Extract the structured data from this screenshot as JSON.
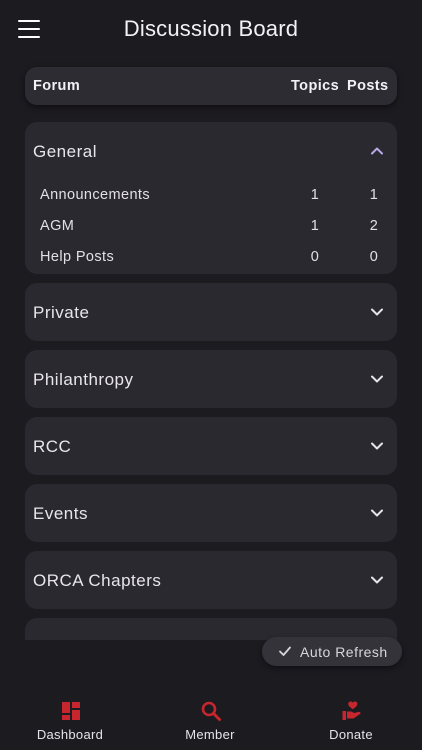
{
  "header": {
    "title": "Discussion Board",
    "menu_icon": "hamburger-menu-icon"
  },
  "columns": {
    "forum": "Forum",
    "topics": "Topics",
    "posts": "Posts"
  },
  "forums": [
    {
      "name": "General",
      "expanded": true,
      "subforums": [
        {
          "name": "Announcements",
          "topics": "1",
          "posts": "1"
        },
        {
          "name": "AGM",
          "topics": "1",
          "posts": "2"
        },
        {
          "name": "Help Posts",
          "topics": "0",
          "posts": "0"
        }
      ]
    },
    {
      "name": "Private",
      "expanded": false
    },
    {
      "name": "Philanthropy",
      "expanded": false
    },
    {
      "name": "RCC",
      "expanded": false
    },
    {
      "name": "Events",
      "expanded": false
    },
    {
      "name": "ORCA Chapters",
      "expanded": false
    }
  ],
  "auto_refresh": {
    "label": "Auto Refresh",
    "icon": "checkmark-icon"
  },
  "bottom_nav": [
    {
      "label": "Dashboard",
      "icon": "dashboard-icon"
    },
    {
      "label": "Member",
      "icon": "search-icon"
    },
    {
      "label": "Donate",
      "icon": "donate-hand-heart-icon"
    }
  ],
  "colors": {
    "accent": "#c8262f",
    "background": "#1c1b20",
    "card": "#2a2930",
    "chevron_up": "#b9a9e8"
  }
}
